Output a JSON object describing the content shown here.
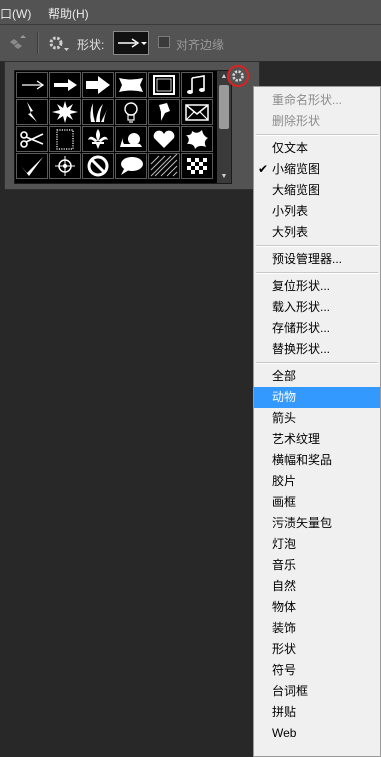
{
  "menubar": {
    "window": "口(W)",
    "help": "帮助(H)"
  },
  "options": {
    "shape_label": "形状:",
    "align_edges": "对齐边缘"
  },
  "picker": {
    "shapes": [
      "arrow-thin",
      "arrow-medium",
      "arrow-bold",
      "banner",
      "frame",
      "music-notes",
      "lightning",
      "starburst",
      "grass",
      "light-bulb",
      "pushpin",
      "envelope",
      "scissors",
      "stamp",
      "fleur-de-lis",
      "snail",
      "heart",
      "splat",
      "checkmark",
      "target",
      "no-sign",
      "speech-bubble",
      "diagonal-lines",
      "checkerboard"
    ]
  },
  "menu": {
    "items": [
      {
        "label": "重命名形状...",
        "state": "disabled"
      },
      {
        "label": "删除形状",
        "state": "disabled"
      },
      {
        "label": "仅文本",
        "state": "normal"
      },
      {
        "label": "小缩览图",
        "state": "checked"
      },
      {
        "label": "大缩览图",
        "state": "normal"
      },
      {
        "label": "小列表",
        "state": "normal"
      },
      {
        "label": "大列表",
        "state": "normal"
      },
      {
        "label": "预设管理器...",
        "state": "normal"
      },
      {
        "label": "复位形状...",
        "state": "normal"
      },
      {
        "label": "载入形状...",
        "state": "normal"
      },
      {
        "label": "存储形状...",
        "state": "normal"
      },
      {
        "label": "替换形状...",
        "state": "normal"
      },
      {
        "label": "全部",
        "state": "normal"
      },
      {
        "label": "动物",
        "state": "selected"
      },
      {
        "label": "箭头",
        "state": "normal"
      },
      {
        "label": "艺术纹理",
        "state": "normal"
      },
      {
        "label": "横幅和奖品",
        "state": "normal"
      },
      {
        "label": "胶片",
        "state": "normal"
      },
      {
        "label": "画框",
        "state": "normal"
      },
      {
        "label": "污渍矢量包",
        "state": "normal"
      },
      {
        "label": "灯泡",
        "state": "normal"
      },
      {
        "label": "音乐",
        "state": "normal"
      },
      {
        "label": "自然",
        "state": "normal"
      },
      {
        "label": "物体",
        "state": "normal"
      },
      {
        "label": "装饰",
        "state": "normal"
      },
      {
        "label": "形状",
        "state": "normal"
      },
      {
        "label": "符号",
        "state": "normal"
      },
      {
        "label": "台词框",
        "state": "normal"
      },
      {
        "label": "拼贴",
        "state": "normal"
      },
      {
        "label": "Web",
        "state": "normal"
      }
    ]
  },
  "colors": {
    "highlight": "#3399ff",
    "menu_bg": "#f0f0f0",
    "panel": "#535353",
    "canvas": "#282828",
    "gear_ring": "#e02020"
  }
}
